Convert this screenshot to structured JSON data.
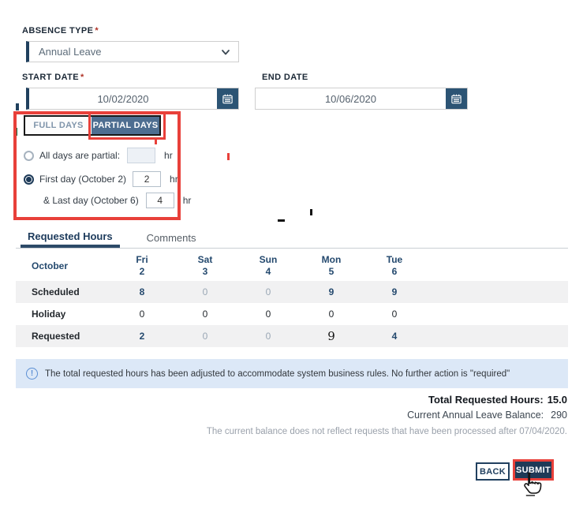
{
  "form": {
    "absence_type": {
      "label": "ABSENCE TYPE",
      "required_marker": "*",
      "value": "Annual Leave"
    },
    "start_date": {
      "label": "START DATE",
      "required_marker": "*",
      "value": "10/02/2020"
    },
    "end_date": {
      "label": "END DATE",
      "value": "10/06/2020"
    },
    "day_tabs": {
      "full_label": "FULL DAYS",
      "partial_label": "PARTIAL DAYS",
      "selected": "PARTIAL DAYS"
    },
    "partial_options": {
      "all_days": {
        "label": "All days are partial:",
        "value": "",
        "unit": "hr",
        "selected": false
      },
      "first_day": {
        "label": "First day (October 2)",
        "value": "2",
        "unit": "hr",
        "selected": true
      },
      "last_day": {
        "label": "& Last day (October 6)",
        "value": "4",
        "unit": "hr"
      }
    }
  },
  "section_tabs": {
    "requested_hours": "Requested Hours",
    "comments": "Comments",
    "active": "Requested Hours"
  },
  "table": {
    "month_label": "October",
    "columns": [
      {
        "day": "Fri",
        "date": "2"
      },
      {
        "day": "Sat",
        "date": "3"
      },
      {
        "day": "Sun",
        "date": "4"
      },
      {
        "day": "Mon",
        "date": "5"
      },
      {
        "day": "Tue",
        "date": "6"
      }
    ],
    "rows": [
      {
        "label": "Scheduled",
        "values": [
          "8",
          "0",
          "0",
          "9",
          "9"
        ]
      },
      {
        "label": "Holiday",
        "values": [
          "0",
          "0",
          "0",
          "0",
          "0"
        ]
      },
      {
        "label": "Requested",
        "values": [
          "2",
          "0",
          "0",
          "9",
          "4"
        ]
      }
    ]
  },
  "notice": {
    "icon": "info-circle-icon",
    "text": "The total requested hours has been adjusted to accommodate system business rules. No further action is \"required\""
  },
  "summary": {
    "total_label": "Total Requested Hours:",
    "total_value": "15.0",
    "balance_label": "Current Annual Leave Balance:",
    "balance_value": "290",
    "disclaimer": "The current balance does not reflect requests that have been processed after 07/04/2020."
  },
  "actions": {
    "back_label": "BACK",
    "submit_label": "SUBMIT"
  },
  "colors": {
    "annotation_red": "#e8403a",
    "navy": "#1e3a57",
    "partial_tab_bg": "#4e6e91",
    "table_navy": "#24496e",
    "muted_value": "#9aa7b5",
    "notice_bg": "#dce8f7",
    "stripe_bg": "#f1f1f2"
  }
}
